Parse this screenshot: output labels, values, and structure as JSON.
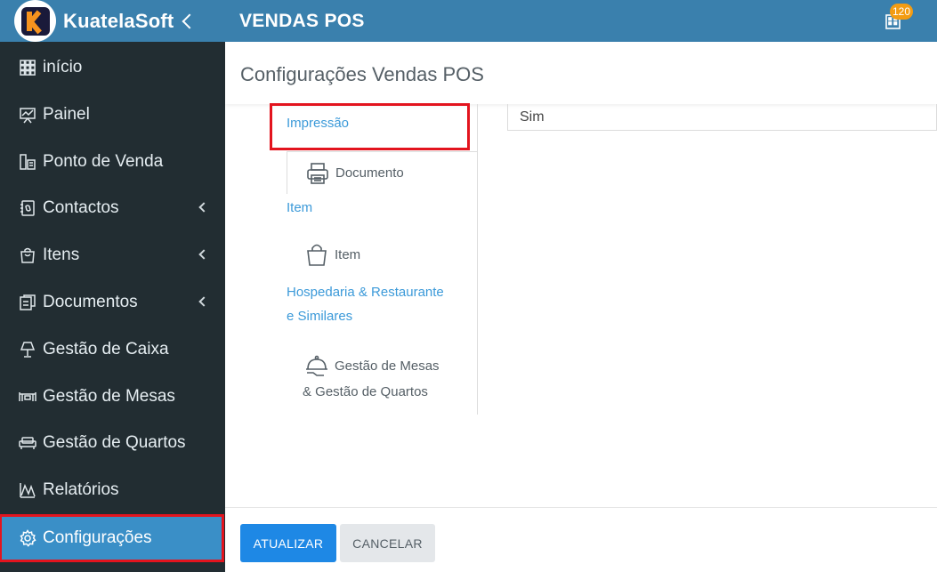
{
  "brand": {
    "name": "KuatelaSoft"
  },
  "topbar": {
    "title": "VENDAS POS",
    "notification_count": "120"
  },
  "sidebar": {
    "items": [
      {
        "label": "início",
        "icon": "grid-icon",
        "has_arrow": false
      },
      {
        "label": "Painel",
        "icon": "presentation-chart-icon",
        "has_arrow": false
      },
      {
        "label": "Ponto de Venda",
        "icon": "pos-terminal-icon",
        "has_arrow": false
      },
      {
        "label": "Contactos",
        "icon": "address-book-icon",
        "has_arrow": true
      },
      {
        "label": "Itens",
        "icon": "shopping-bag-icon",
        "has_arrow": true
      },
      {
        "label": "Documentos",
        "icon": "documents-icon",
        "has_arrow": true
      },
      {
        "label": "Gestão de Caixa",
        "icon": "lamp-icon",
        "has_arrow": false
      },
      {
        "label": "Gestão de Mesas",
        "icon": "table-icon",
        "has_arrow": false
      },
      {
        "label": "Gestão de Quartos",
        "icon": "sofa-icon",
        "has_arrow": false
      },
      {
        "label": "Relatórios",
        "icon": "reports-chart-icon",
        "has_arrow": false
      },
      {
        "label": "Configurações",
        "icon": "gear-icon",
        "has_arrow": false,
        "active": true
      }
    ]
  },
  "page": {
    "title": "Configurações Vendas POS"
  },
  "tabs": {
    "impressao_label": "Impressão",
    "documento_label": "Documento",
    "item_section_label": "Item",
    "item_label": "Item",
    "hospedaria_label_line1": "Hospedaria & Restaurante",
    "hospedaria_label_line2": "e Similares",
    "mesas_label_line1": "Gestão de Mesas",
    "mesas_label_line2": "& Gestão de Quartos"
  },
  "field": {
    "value": "Sim"
  },
  "footer": {
    "update_label": "ATUALIZAR",
    "cancel_label": "CANCELAR"
  },
  "colors": {
    "topbar": "#3a80ad",
    "sidebar": "#222d32",
    "active_item": "#3a8fc7",
    "link": "#3c9ad9",
    "primary_button": "#1e88e5",
    "highlight": "#e3141e",
    "badge": "#f39c12"
  }
}
